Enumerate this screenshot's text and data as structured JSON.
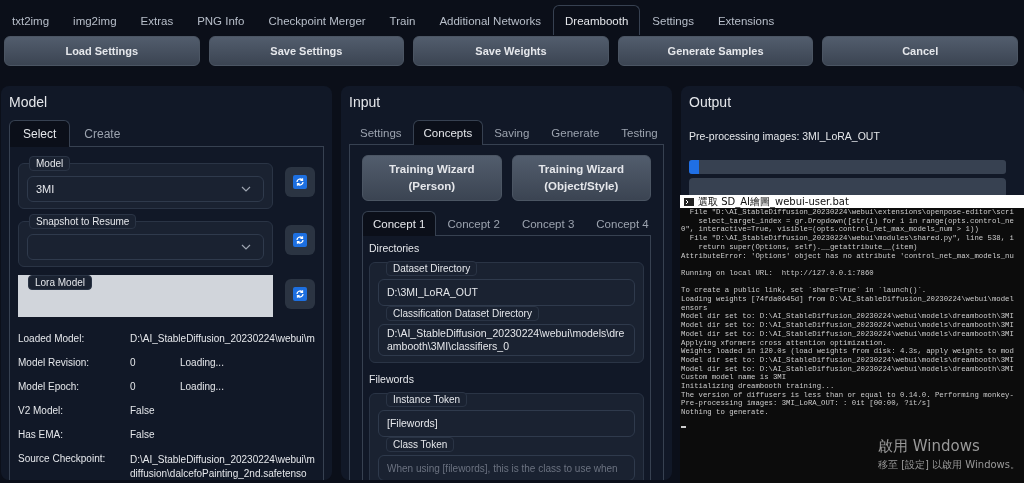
{
  "top_tabs": [
    {
      "label": "txt2img",
      "selected": false
    },
    {
      "label": "img2img",
      "selected": false
    },
    {
      "label": "Extras",
      "selected": false
    },
    {
      "label": "PNG Info",
      "selected": false
    },
    {
      "label": "Checkpoint Merger",
      "selected": false
    },
    {
      "label": "Train",
      "selected": false
    },
    {
      "label": "Additional Networks",
      "selected": false
    },
    {
      "label": "Dreambooth",
      "selected": true
    },
    {
      "label": "Settings",
      "selected": false
    },
    {
      "label": "Extensions",
      "selected": false
    }
  ],
  "action_buttons": [
    "Load Settings",
    "Save Settings",
    "Save Weights",
    "Generate Samples",
    "Cancel"
  ],
  "model_panel": {
    "title": "Model",
    "tabs": [
      {
        "label": "Select",
        "selected": true
      },
      {
        "label": "Create",
        "selected": false
      }
    ],
    "model_field": {
      "label": "Model",
      "value": "3MI"
    },
    "snapshot_field": {
      "label": "Snapshot to Resume"
    },
    "lora_field": {
      "label": "Lora Model"
    },
    "details": [
      {
        "label": "Loaded Model:",
        "value": "D:\\AI_StableDiffusion_20230224\\webui\\m"
      },
      {
        "label": "Model Revision:",
        "value": "0",
        "status": "Loading..."
      },
      {
        "label": "Model Epoch:",
        "value": "0",
        "status": "Loading..."
      },
      {
        "label": "V2 Model:",
        "value": "False"
      },
      {
        "label": "Has EMA:",
        "value": "False"
      },
      {
        "label": "Source Checkpoint:",
        "value": "D:\\AI_StableDiffusion_20230224\\webui\\m",
        "value_line_2": "diffusion\\dalcefoPainting_2nd.safetenso"
      }
    ]
  },
  "input_panel": {
    "title": "Input",
    "tabs": [
      {
        "label": "Settings",
        "selected": false
      },
      {
        "label": "Concepts",
        "selected": true
      },
      {
        "label": "Saving",
        "selected": false
      },
      {
        "label": "Generate",
        "selected": false
      },
      {
        "label": "Testing",
        "selected": false
      }
    ],
    "wizard_buttons": [
      [
        "Training Wizard",
        "(Person)"
      ],
      [
        "Training Wizard",
        "(Object/Style)"
      ]
    ],
    "concept_tabs": [
      {
        "label": "Concept 1",
        "selected": true
      },
      {
        "label": "Concept 2",
        "selected": false
      },
      {
        "label": "Concept 3",
        "selected": false
      },
      {
        "label": "Concept 4",
        "selected": false
      }
    ],
    "sections": [
      {
        "title": "Directories",
        "fields": [
          {
            "label": "Dataset Directory",
            "value": "D:\\3MI_LoRA_OUT"
          },
          {
            "label": "Classification Dataset Directory",
            "value": "D:\\AI_StableDiffusion_20230224\\webui\\models\\dreambooth\\3MI\\classifiers_0"
          }
        ]
      },
      {
        "title": "Filewords",
        "fields": [
          {
            "label": "Instance Token",
            "value": "[Filewords]"
          },
          {
            "label": "Class Token",
            "placeholder": "When using [filewords], this is the class to use when"
          }
        ]
      }
    ]
  },
  "output_panel": {
    "title": "Output",
    "status": "Pre-processing images: 3MI_LoRA_OUT",
    "progress": {
      "level": 0.03
    }
  },
  "console": {
    "title": "選取 SD_AI繪圖_webui-user.bat",
    "blocks": [
      [
        "  File \"D:\\AI_StableDiffusion_20230224\\webui\\extensions\\openpose-editor\\scri",
        "    select_target_index = gr.Dropdown([str(i) for i in range(opts.control_ne",
        "0\", interactive=True, visible=(opts.control_net_max_models_num > 1))",
        "  File \"D:\\AI_StableDiffusion_20230224\\webui\\modules\\shared.py\", line 538, i",
        "    return super(Options, self).__getattribute__(item)",
        "AttributeError: 'Options' object has no attribute 'control_net_max_models_nu"
      ],
      [
        "Running on local URL:  http://127.0.0.1:7860"
      ],
      [
        "To create a public link, set `share=True` in `launch()`.",
        "Loading weights [74fda0645d] from D:\\AI_StableDiffusion_20230224\\webui\\model",
        "ensors",
        "Model dir set to: D:\\AI_StableDiffusion_20230224\\webui\\models\\dreambooth\\3MI",
        "Model dir set to: D:\\AI_StableDiffusion_20230224\\webui\\models\\dreambooth\\3MI",
        "Model dir set to: D:\\AI_StableDiffusion_20230224\\webui\\models\\dreambooth\\3MI",
        "Applying xformers cross attention optimization.",
        "Weights loaded in 120.0s (load weights from disk: 4.3s, apply weights to mod",
        "Model dir set to: D:\\AI_StableDiffusion_20230224\\webui\\models\\dreambooth\\3MI",
        "Model dir set to: D:\\AI_StableDiffusion_20230224\\webui\\models\\dreambooth\\3MI",
        "Custom model name is 3MI",
        "Initializing dreambooth training...",
        "The version of diffusers is less than or equal to 0.14.0. Performing monkey-",
        "Pre-processing images: 3MI_LoRA_OUT: : 0it [00:00, ?it/s]",
        "Nothing to generate."
      ]
    ]
  },
  "os_notice": {
    "title": "啟用 Windows",
    "text": "移至 [設定] 以啟用 Windows。"
  }
}
